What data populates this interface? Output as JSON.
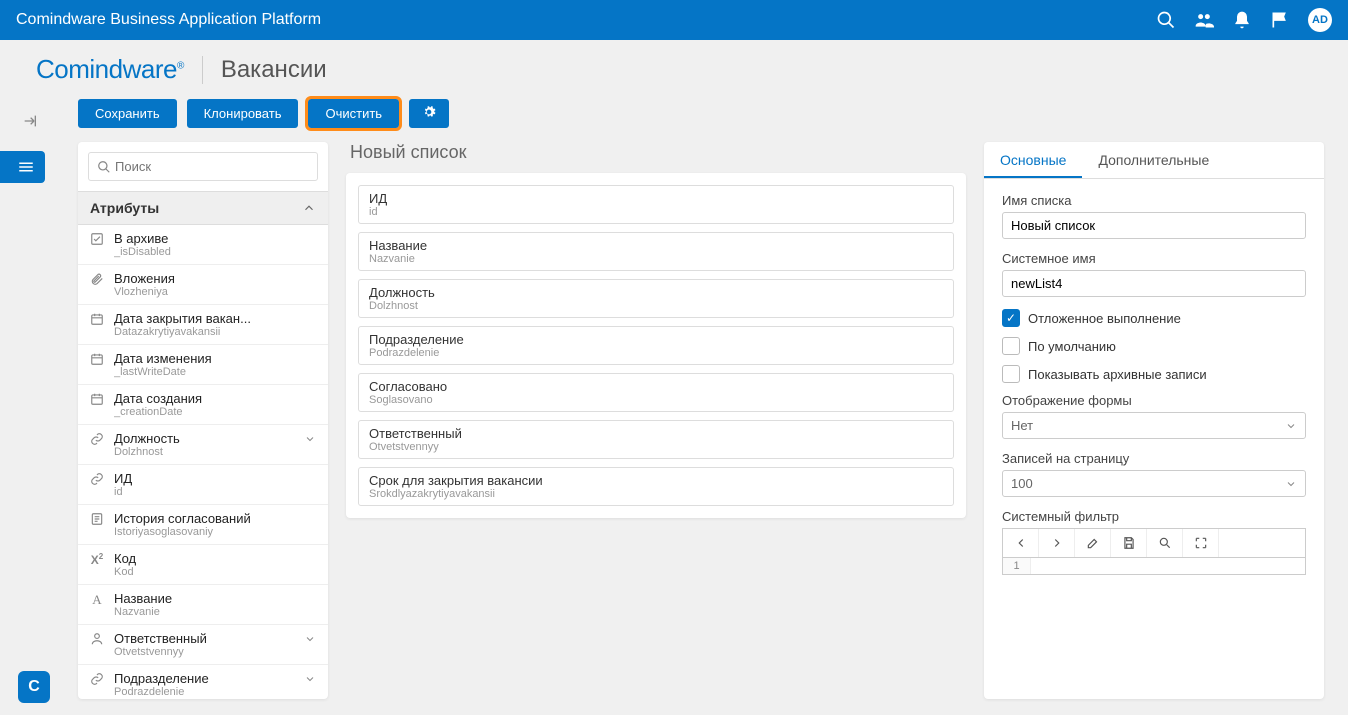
{
  "topbar": {
    "title": "Comindware Business Application Platform",
    "avatar": "AD"
  },
  "logo": {
    "brand": "Comindware",
    "page": "Вакансии"
  },
  "toolbar": {
    "save": "Сохранить",
    "clone": "Клонировать",
    "clear": "Очистить"
  },
  "search": {
    "placeholder": "Поиск"
  },
  "attributes": {
    "header": "Атрибуты",
    "items": [
      {
        "icon": "checkbox",
        "label": "В архиве",
        "sub": "_isDisabled"
      },
      {
        "icon": "clip",
        "label": "Вложения",
        "sub": "Vlozheniya"
      },
      {
        "icon": "calendar",
        "label": "Дата закрытия вакан...",
        "sub": "Datazakrytiyavakansii"
      },
      {
        "icon": "calendar",
        "label": "Дата изменения",
        "sub": "_lastWriteDate"
      },
      {
        "icon": "calendar",
        "label": "Дата создания",
        "sub": "_creationDate"
      },
      {
        "icon": "link",
        "label": "Должность",
        "sub": "Dolzhnost",
        "chev": true
      },
      {
        "icon": "link",
        "label": "ИД",
        "sub": "id"
      },
      {
        "icon": "doc",
        "label": "История согласований",
        "sub": "Istoriyasoglasovaniy"
      },
      {
        "icon": "x2",
        "label": "Код",
        "sub": "Kod"
      },
      {
        "icon": "A",
        "label": "Название",
        "sub": "Nazvanie"
      },
      {
        "icon": "person",
        "label": "Ответственный",
        "sub": "Otvetstvennyy",
        "chev": true
      },
      {
        "icon": "link",
        "label": "Подразделение",
        "sub": "Podrazdelenie",
        "chev": true
      }
    ]
  },
  "center": {
    "title": "Новый список",
    "fields": [
      {
        "label": "ИД",
        "sub": "id"
      },
      {
        "label": "Название",
        "sub": "Nazvanie"
      },
      {
        "label": "Должность",
        "sub": "Dolzhnost"
      },
      {
        "label": "Подразделение",
        "sub": "Podrazdelenie"
      },
      {
        "label": "Согласовано",
        "sub": "Soglasovano"
      },
      {
        "label": "Ответственный",
        "sub": "Otvetstvennyy"
      },
      {
        "label": "Срок для закрытия вакансии",
        "sub": "Srokdlyazakrytiyavakansii"
      }
    ]
  },
  "tabs": {
    "main": "Основные",
    "extra": "Дополнительные"
  },
  "props": {
    "listName": {
      "label": "Имя списка",
      "value": "Новый список"
    },
    "sysName": {
      "label": "Системное имя",
      "value": "newList4"
    },
    "deferred": "Отложенное выполнение",
    "default": "По умолчанию",
    "showArchive": "Показывать архивные записи",
    "formDisplay": {
      "label": "Отображение формы",
      "value": "Нет"
    },
    "perPage": {
      "label": "Записей на страницу",
      "value": "100"
    },
    "sysFilter": "Системный фильтр",
    "lineNum": "1"
  }
}
